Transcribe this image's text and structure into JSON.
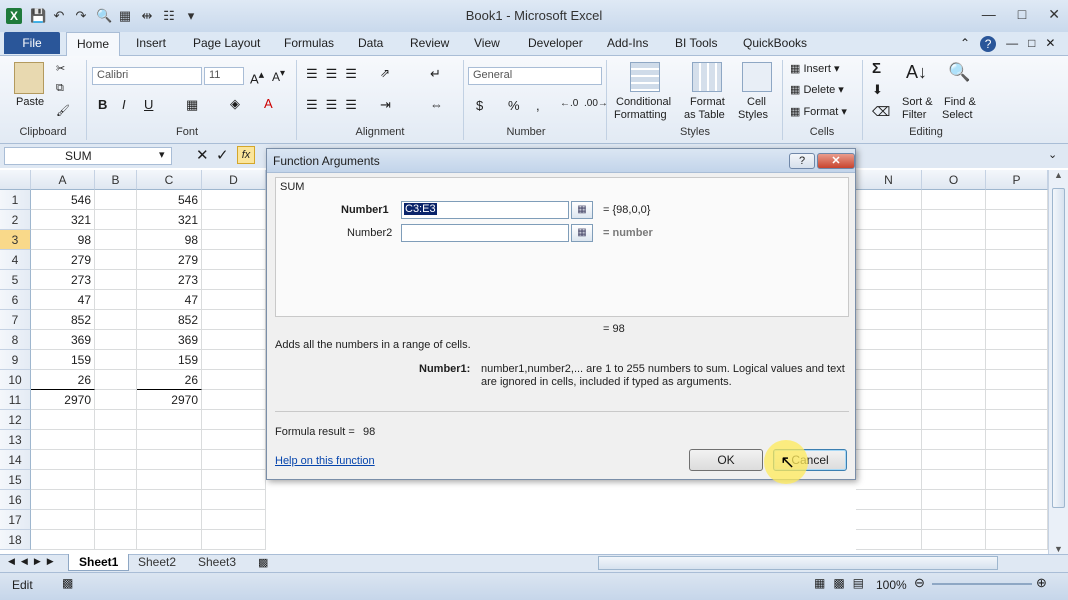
{
  "window": {
    "title": "Book1 - Microsoft Excel"
  },
  "ribbon": {
    "tabs": [
      "File",
      "Home",
      "Insert",
      "Page Layout",
      "Formulas",
      "Data",
      "Review",
      "View",
      "Developer",
      "Add-Ins",
      "BI Tools",
      "QuickBooks"
    ],
    "clipboard": {
      "paste": "Paste",
      "label": "Clipboard"
    },
    "font": {
      "name": "Calibri",
      "size": "11",
      "label": "Font"
    },
    "alignment": {
      "label": "Alignment"
    },
    "number": {
      "format": "General",
      "label": "Number",
      "currency": "$",
      "percent": "%",
      "comma": ","
    },
    "styles": {
      "cond_fmt": "Conditional",
      "cond_fmt2": "Formatting",
      "fmt_table": "Format",
      "fmt_table2": "as Table",
      "cell_styles": "Cell",
      "cell_styles2": "Styles",
      "label": "Styles"
    },
    "cells": {
      "insert": "Insert",
      "delete": "Delete",
      "format": "Format",
      "label": "Cells"
    },
    "editing": {
      "sort": "Sort &",
      "sort2": "Filter",
      "find": "Find &",
      "find2": "Select",
      "label": "Editing"
    }
  },
  "formula_bar": {
    "name_box": "SUM",
    "fx": "fx"
  },
  "columns": [
    "A",
    "B",
    "C",
    "D",
    "N",
    "O",
    "P"
  ],
  "rows": [
    {
      "n": "1",
      "a": "546",
      "c": "546"
    },
    {
      "n": "2",
      "a": "321",
      "c": "321"
    },
    {
      "n": "3",
      "a": "98",
      "c": "98"
    },
    {
      "n": "4",
      "a": "279",
      "c": "279"
    },
    {
      "n": "5",
      "a": "273",
      "c": "273"
    },
    {
      "n": "6",
      "a": "47",
      "c": "47"
    },
    {
      "n": "7",
      "a": "852",
      "c": "852"
    },
    {
      "n": "8",
      "a": "369",
      "c": "369"
    },
    {
      "n": "9",
      "a": "159",
      "c": "159"
    },
    {
      "n": "10",
      "a": "26",
      "c": "26"
    },
    {
      "n": "11",
      "a": "2970",
      "c": "2970"
    },
    {
      "n": "12",
      "a": "",
      "c": ""
    },
    {
      "n": "13",
      "a": "",
      "c": ""
    },
    {
      "n": "14",
      "a": "",
      "c": ""
    },
    {
      "n": "15",
      "a": "",
      "c": ""
    },
    {
      "n": "16",
      "a": "",
      "c": ""
    },
    {
      "n": "17",
      "a": "",
      "c": ""
    },
    {
      "n": "18",
      "a": "",
      "c": ""
    }
  ],
  "sheets": [
    "Sheet1",
    "Sheet2",
    "Sheet3"
  ],
  "status": {
    "mode": "Edit",
    "zoom": "100%"
  },
  "dialog": {
    "title": "Function Arguments",
    "func": "SUM",
    "arg1_label": "Number1",
    "arg1_value": "C3:E3",
    "arg1_result": "=  {98,0,0}",
    "arg2_label": "Number2",
    "arg2_value": "",
    "arg2_result": "=  number",
    "total": "=  98",
    "description": "Adds all the numbers in a range of cells.",
    "help_label": "Number1:",
    "help_text1": "number1,number2,... are 1 to 255 numbers to sum. Logical values and text",
    "help_text2": "are ignored in cells, included if typed as arguments.",
    "result_label": "Formula result =",
    "result_value": "98",
    "help_link": "Help on this function",
    "ok": "OK",
    "cancel": "Cancel"
  }
}
